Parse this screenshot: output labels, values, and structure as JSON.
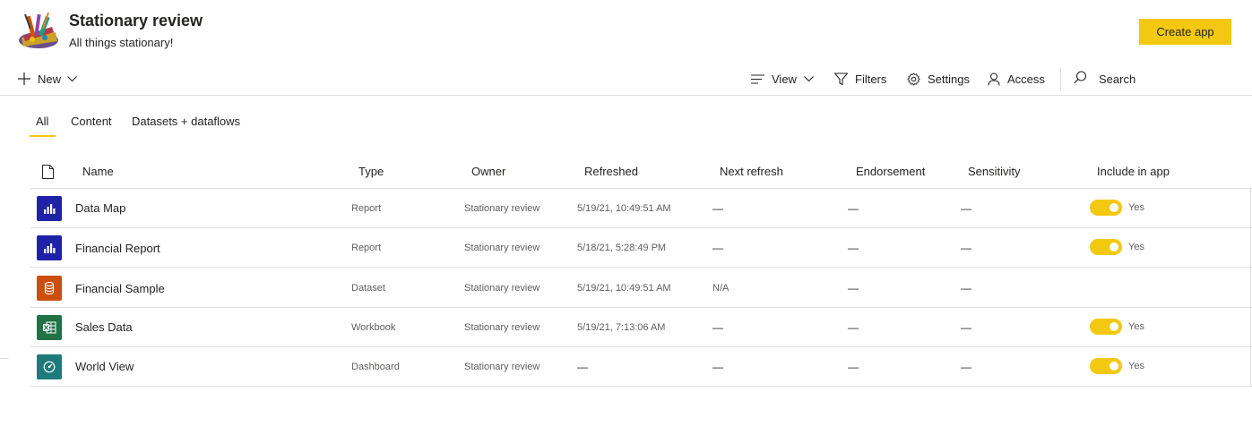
{
  "workspace": {
    "title": "Stationary review",
    "description": "All things stationary!",
    "create_app_label": "Create app"
  },
  "toolbar": {
    "new_label": "New",
    "view_label": "View",
    "filters_label": "Filters",
    "settings_label": "Settings",
    "access_label": "Access",
    "search_placeholder": "Search"
  },
  "tabs": [
    {
      "label": "All",
      "active": true
    },
    {
      "label": "Content",
      "active": false
    },
    {
      "label": "Datasets + dataflows",
      "active": false
    }
  ],
  "table": {
    "columns": [
      "Name",
      "Type",
      "Owner",
      "Refreshed",
      "Next refresh",
      "Endorsement",
      "Sensitivity",
      "Include in app"
    ],
    "rows": [
      {
        "name": "Data Map",
        "type": "Report",
        "owner": "Stationary review",
        "refreshed": "5/19/21, 10:49:51 AM",
        "next_refresh": "—",
        "endorsement": "—",
        "sensitivity": "—",
        "include_in_app": "Yes",
        "icon": "report-icon",
        "icon_color": "#1F22A6"
      },
      {
        "name": "Financial Report",
        "type": "Report",
        "owner": "Stationary review",
        "refreshed": "5/18/21, 5:28:49 PM",
        "next_refresh": "—",
        "endorsement": "—",
        "sensitivity": "—",
        "include_in_app": "Yes",
        "icon": "report-icon",
        "icon_color": "#1F22A6"
      },
      {
        "name": "Financial Sample",
        "type": "Dataset",
        "owner": "Stationary review",
        "refreshed": "5/19/21, 10:49:51 AM",
        "next_refresh": "N/A",
        "endorsement": "—",
        "sensitivity": "—",
        "include_in_app": "",
        "icon": "dataset-icon",
        "icon_color": "#CA5010"
      },
      {
        "name": "Sales Data",
        "type": "Workbook",
        "owner": "Stationary review",
        "refreshed": "5/19/21, 7:13:06 AM",
        "next_refresh": "—",
        "endorsement": "—",
        "sensitivity": "—",
        "include_in_app": "Yes",
        "icon": "workbook-icon",
        "icon_color": "#217346"
      },
      {
        "name": "World View",
        "type": "Dashboard",
        "owner": "Stationary review",
        "refreshed": "—",
        "next_refresh": "—",
        "endorsement": "—",
        "sensitivity": "—",
        "include_in_app": "Yes",
        "icon": "dashboard-icon",
        "icon_color": "#1F7A7A"
      }
    ]
  },
  "colors": {
    "accent": "#F2C811",
    "text": "#252423",
    "muted": "#605e5c",
    "border": "#e1dfdd"
  }
}
